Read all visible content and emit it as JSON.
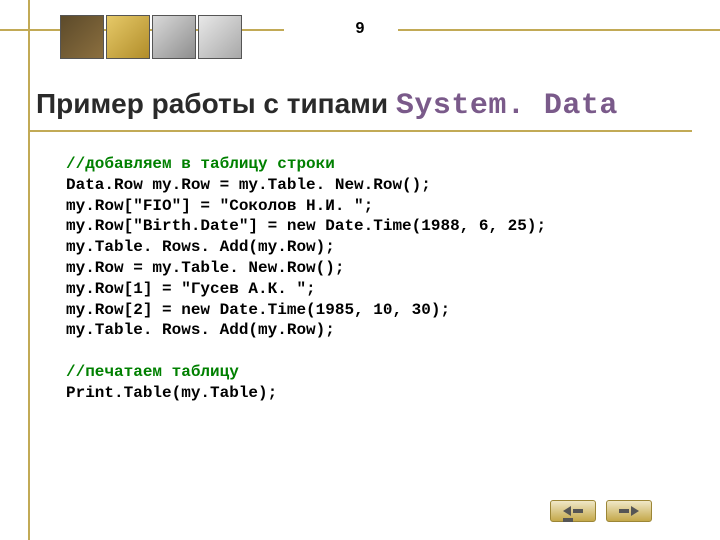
{
  "page_number": "9",
  "title_plain": "Пример работы с типами ",
  "title_mono": "System. Data",
  "code_block1_comment": "//добавляем в таблицу строки",
  "code_block1": "Data.Row my.Row = my.Table. New.Row();\nmy.Row[\"FIO\"] = \"Соколов Н.И. \";\nmy.Row[\"Birth.Date\"] = new Date.Time(1988, 6, 25);\nmy.Table. Rows. Add(my.Row);\nmy.Row = my.Table. New.Row();\nmy.Row[1] = \"Гусев А.К. \";\nmy.Row[2] = new Date.Time(1985, 10, 30);\nmy.Table. Rows. Add(my.Row);",
  "code_block2_comment": "//печатаем таблицу",
  "code_block2": "Print.Table(my.Table);",
  "nav": {
    "prev": "prev",
    "next": "next"
  }
}
